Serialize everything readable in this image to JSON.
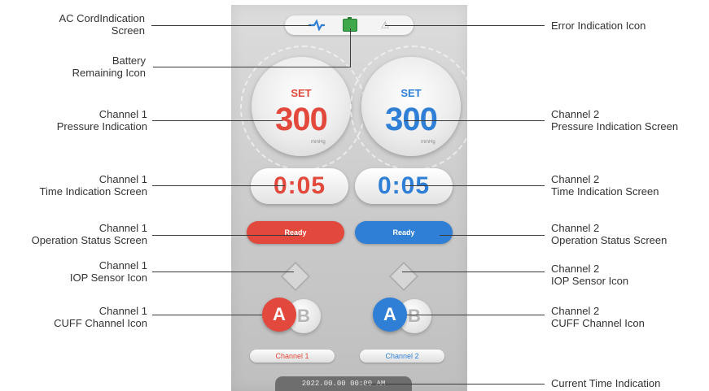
{
  "labels": {
    "ac_cord": [
      "AC CordIndication",
      "Screen"
    ],
    "battery": [
      "Battery",
      "Remaining Icon"
    ],
    "ch1_pressure": [
      "Channel 1",
      "Pressure Indication"
    ],
    "ch1_time": [
      "Channel 1",
      "Time Indication Screen"
    ],
    "ch1_status": [
      "Channel 1",
      "Operation Status Screen"
    ],
    "ch1_iop": [
      "Channel 1",
      "IOP Sensor Icon"
    ],
    "ch1_cuff": [
      "Channel 1",
      "CUFF Channel Icon"
    ],
    "error": [
      "Error Indication  Icon"
    ],
    "ch2_pressure": [
      "Channel 2",
      "Pressure Indication Screen"
    ],
    "ch2_time": [
      "Channel 2",
      "Time Indication Screen"
    ],
    "ch2_status": [
      "Channel 2",
      "Operation Status Screen"
    ],
    "ch2_iop": [
      "Channel 2",
      "IOP Sensor Icon"
    ],
    "ch2_cuff": [
      "Channel 2",
      "CUFF Channel Icon"
    ],
    "current_time": [
      "Current Time Indication"
    ]
  },
  "screen": {
    "ch1": {
      "set": "SET",
      "pressure": "300",
      "unit": "mmHg",
      "time": "0:05",
      "status": "Ready",
      "cuff_a": "A",
      "cuff_b": "B",
      "channel": "Channel 1",
      "color": "#e2483b"
    },
    "ch2": {
      "set": "SET",
      "pressure": "300",
      "unit": "mmHg",
      "time": "0:05",
      "status": "Ready",
      "cuff_a": "A",
      "cuff_b": "B",
      "channel": "Channel 2",
      "color": "#2f7fd6"
    },
    "clock": "2022.00.00  00:00 AM"
  },
  "icons": {
    "ac_cord": "ac-cord-icon",
    "battery": "battery-icon",
    "error": "error-icon",
    "iop": "iop-sensor-icon"
  }
}
